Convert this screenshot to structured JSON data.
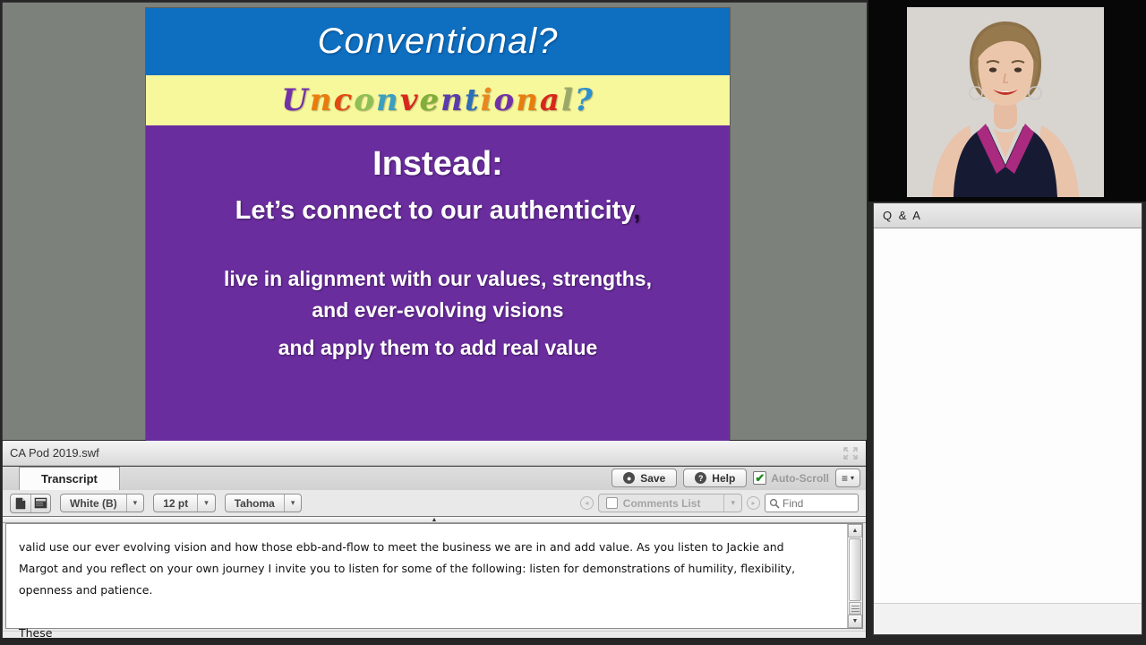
{
  "slide": {
    "title_conventional": "Conventional?",
    "title_unconventional_letters": [
      {
        "ch": "U",
        "color": "#7231a8"
      },
      {
        "ch": "n",
        "color": "#e87d0e"
      },
      {
        "ch": "c",
        "color": "#e04a12"
      },
      {
        "ch": "o",
        "color": "#8fbf55"
      },
      {
        "ch": "n",
        "color": "#3a9fc0"
      },
      {
        "ch": "v",
        "color": "#d7281d"
      },
      {
        "ch": "e",
        "color": "#7fae3b"
      },
      {
        "ch": "n",
        "color": "#5a3daa"
      },
      {
        "ch": "t",
        "color": "#2c6fb8"
      },
      {
        "ch": "i",
        "color": "#e8881e"
      },
      {
        "ch": "o",
        "color": "#7231a8"
      },
      {
        "ch": "n",
        "color": "#e87d0e"
      },
      {
        "ch": "a",
        "color": "#d7281d"
      },
      {
        "ch": "l",
        "color": "#9aa86a"
      },
      {
        "ch": "?",
        "color": "#2e8fd0"
      }
    ],
    "instead": "Instead:",
    "connect_line": "Let’s connect to our authenticity",
    "connect_comma": ",",
    "body_line1": "live in alignment with our values, strengths,",
    "body_line2": "and ever-evolving visions",
    "body_line3": "and apply them to add real value"
  },
  "transcript_panel": {
    "window_title": "CA Pod 2019.swf",
    "tab_label": "Transcript",
    "save_label": "Save",
    "help_label": "Help",
    "help_glyph": "?",
    "autoscroll_label": "Auto-Scroll",
    "autoscroll_check_glyph": "✔",
    "menu_glyph": "≡",
    "caret_glyph": "▾",
    "splitter_glyph": "▲",
    "scroll_up_glyph": "▲",
    "scroll_down_glyph": "▼",
    "nav_prev_glyph": "◂",
    "nav_next_glyph": "▸",
    "font_color_value": "White (B)",
    "font_size_value": "12 pt",
    "font_family_value": "Tahoma",
    "comments_list_label": "Comments List",
    "find_placeholder": "Find",
    "transcript_paragraph": "valid use our ever evolving vision and how those ebb-and-flow to meet the business we are in and add value. As you listen to Jackie and Margot and you reflect on your own journey I invite you to listen for some of the following: listen for demonstrations of humility, flexibility, openness and patience.",
    "transcript_paragraph2": "These"
  },
  "qa_panel": {
    "title": "Q & A"
  },
  "colors": {
    "slide_blue": "#0e6ec0",
    "slide_yellow": "#f7f79b",
    "slide_purple": "#6a2d9e",
    "stage_gray": "#7d817c",
    "check_green": "#1d8a1d"
  }
}
